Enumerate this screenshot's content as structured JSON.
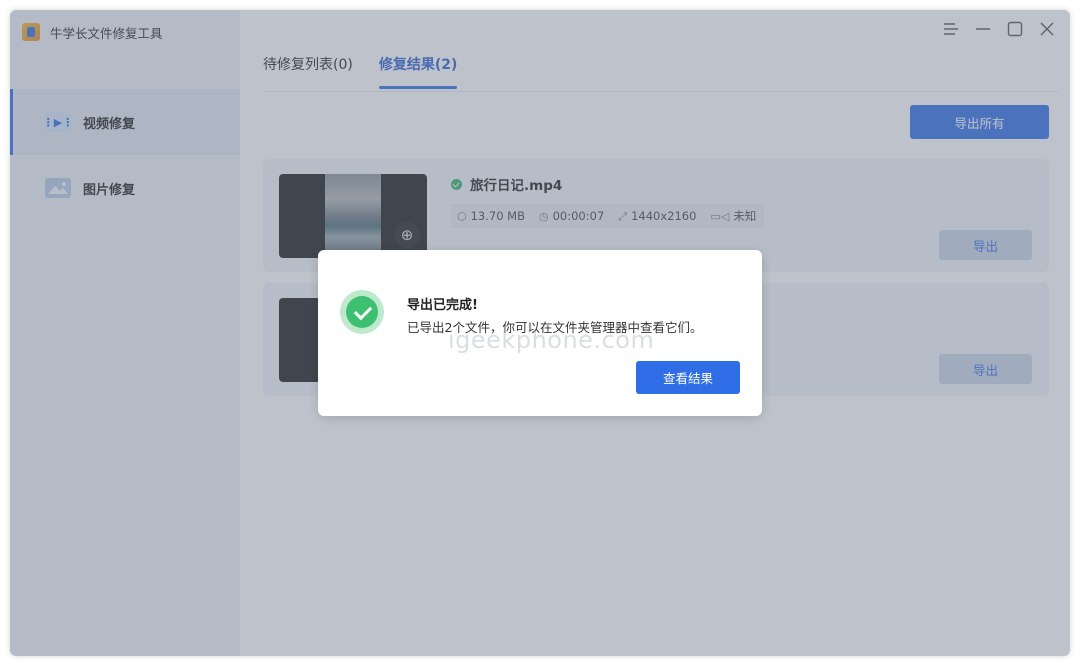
{
  "app": {
    "title": "牛学长文件修复工具"
  },
  "sidebar": {
    "items": [
      {
        "label": "视频修复",
        "icon": "video-icon",
        "active": true
      },
      {
        "label": "图片修复",
        "icon": "image-icon",
        "active": false
      }
    ]
  },
  "window_controls": {
    "menu": "menu-icon",
    "minimize": "minimize-icon",
    "maximize": "maximize-icon",
    "close": "close-icon"
  },
  "tabs": [
    {
      "label": "待修复列表(0)",
      "active": false
    },
    {
      "label": "修复结果(2)",
      "active": true
    }
  ],
  "toolbar": {
    "export_all_label": "导出所有"
  },
  "results": [
    {
      "file_name": "旅行日记.mp4",
      "size": "13.70 MB",
      "duration": "00:00:07",
      "resolution": "1440x2160",
      "camera": "未知",
      "export_label": "导出"
    },
    {
      "export_label": "导出"
    }
  ],
  "dialog": {
    "title": "导出已完成!",
    "message": "已导出2个文件，你可以在文件夹管理器中查看它们。",
    "button_label": "查看结果",
    "watermark": "igeekphone.com"
  },
  "colors": {
    "accent": "#2f6ee6",
    "success": "#3ec071"
  }
}
